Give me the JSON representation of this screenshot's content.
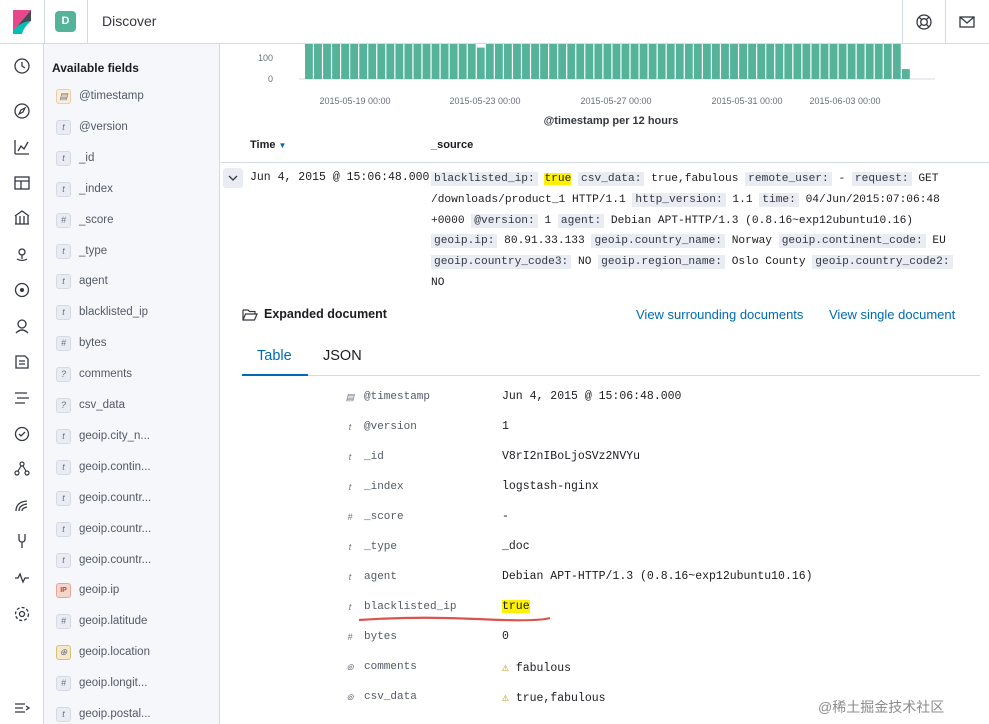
{
  "app": {
    "space_initial": "D",
    "title": "Discover"
  },
  "topbar_icons": [
    "help-icon",
    "mail-icon"
  ],
  "nav_icons": [
    "recent-icon",
    "discover-icon",
    "visualize-icon",
    "dashboard-icon",
    "canvas-icon",
    "maps-icon",
    "ml-icon",
    "metrics-icon",
    "logs-icon",
    "apm-icon",
    "uptime-icon",
    "graph-icon",
    "siem-icon",
    "devtools-icon",
    "monitoring-icon",
    "management-icon"
  ],
  "sidebar": {
    "heading": "Available fields",
    "fields": [
      {
        "type": "date",
        "name": "@timestamp"
      },
      {
        "type": "t",
        "name": "@version"
      },
      {
        "type": "t",
        "name": "_id"
      },
      {
        "type": "t",
        "name": "_index"
      },
      {
        "type": "#",
        "name": "_score"
      },
      {
        "type": "t",
        "name": "_type"
      },
      {
        "type": "t",
        "name": "agent"
      },
      {
        "type": "t",
        "name": "blacklisted_ip"
      },
      {
        "type": "#",
        "name": "bytes"
      },
      {
        "type": "?",
        "name": "comments"
      },
      {
        "type": "?",
        "name": "csv_data"
      },
      {
        "type": "t",
        "name": "geoip.city_n..."
      },
      {
        "type": "t",
        "name": "geoip.contin..."
      },
      {
        "type": "t",
        "name": "geoip.countr..."
      },
      {
        "type": "t",
        "name": "geoip.countr..."
      },
      {
        "type": "t",
        "name": "geoip.countr..."
      },
      {
        "type": "ip",
        "name": "geoip.ip"
      },
      {
        "type": "#",
        "name": "geoip.latitude"
      },
      {
        "type": "geo",
        "name": "geoip.location"
      },
      {
        "type": "#",
        "name": "geoip.longit..."
      },
      {
        "type": "t",
        "name": "geoip.postal..."
      }
    ]
  },
  "chart_data": {
    "type": "bar",
    "xlabel": "@timestamp per 12 hours",
    "ylabel": "",
    "y_ticks": [
      "100",
      "0"
    ],
    "x_ticks": [
      "2015-05-19 00:00",
      "2015-05-23 00:00",
      "2015-05-27 00:00",
      "2015-05-31 00:00",
      "2015-06-03 00:00"
    ],
    "ylim": [
      0,
      130
    ],
    "color": "#54b399",
    "values": [
      130,
      130,
      130,
      130,
      130,
      130,
      130,
      130,
      130,
      130,
      130,
      130,
      130,
      130,
      130,
      130,
      130,
      130,
      130,
      95,
      130,
      130,
      130,
      130,
      130,
      130,
      130,
      130,
      130,
      130,
      130,
      130,
      130,
      130,
      130,
      110,
      130,
      130,
      130,
      130,
      130,
      110,
      130,
      130,
      130,
      130,
      130,
      130,
      115,
      130,
      130,
      130,
      130,
      130,
      130,
      130,
      130,
      130,
      130,
      130,
      130,
      130,
      130,
      130,
      130,
      130,
      30
    ]
  },
  "table": {
    "col_time": "Time",
    "col_source": "_source",
    "row_time": "Jun 4, 2015 @ 15:06:48.000",
    "source_pairs": [
      {
        "k": "blacklisted_ip:",
        "v": "true",
        "hl": true
      },
      {
        "k": "csv_data:",
        "v": "true,fabulous"
      },
      {
        "k": "remote_user:",
        "v": "-"
      },
      {
        "k": "request:",
        "v": "GET /downloads/product_1 HTTP/1.1"
      },
      {
        "k": "http_version:",
        "v": "1.1"
      },
      {
        "k": "time:",
        "v": "04/Jun/2015:07:06:48 +0000"
      },
      {
        "k": "@version:",
        "v": "1"
      },
      {
        "k": "agent:",
        "v": "Debian APT-HTTP/1.3 (0.8.16~exp12ubuntu10.16)"
      },
      {
        "k": "geoip.ip:",
        "v": "80.91.33.133"
      },
      {
        "k": "geoip.country_name:",
        "v": "Norway"
      },
      {
        "k": "geoip.continent_code:",
        "v": "EU"
      },
      {
        "k": "geoip.country_code3:",
        "v": "NO"
      },
      {
        "k": "geoip.region_name:",
        "v": "Oslo County"
      },
      {
        "k": "geoip.country_code2:",
        "v": "NO"
      }
    ]
  },
  "expanded": {
    "title": "Expanded document",
    "link_surrounding": "View surrounding documents",
    "link_single": "View single document",
    "tab_table": "Table",
    "tab_json": "JSON",
    "rows": [
      {
        "type": "date",
        "key": "@timestamp",
        "value": "Jun 4, 2015 @ 15:06:48.000"
      },
      {
        "type": "t",
        "key": "@version",
        "value": "1"
      },
      {
        "type": "t",
        "key": "_id",
        "value": "V8rI2nIBoLjoSVz2NVYu"
      },
      {
        "type": "t",
        "key": "_index",
        "value": "logstash-nginx"
      },
      {
        "type": "#",
        "key": "_score",
        "value": " -"
      },
      {
        "type": "t",
        "key": "_type",
        "value": "_doc"
      },
      {
        "type": "t",
        "key": "agent",
        "value": "Debian APT-HTTP/1.3 (0.8.16~exp12ubuntu10.16)"
      },
      {
        "type": "t",
        "key": "blacklisted_ip",
        "value": "true",
        "hl": true
      },
      {
        "type": "#",
        "key": "bytes",
        "value": "0"
      },
      {
        "type": "?",
        "key": "comments",
        "value": "fabulous",
        "warn": true
      },
      {
        "type": "?",
        "key": "csv_data",
        "value": "true,fabulous",
        "warn": true
      }
    ]
  },
  "watermark": "@稀土掘金技术社区"
}
